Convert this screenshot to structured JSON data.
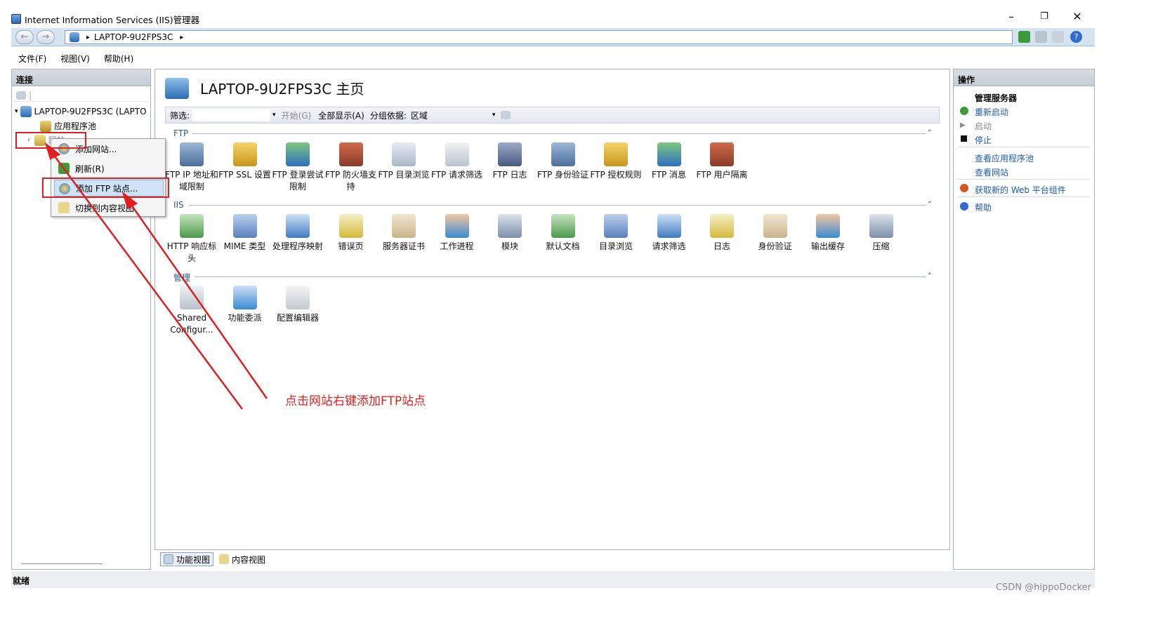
{
  "window": {
    "title": "Internet Information Services (IIS)管理器",
    "minimize": "–",
    "restore": "❐",
    "close": "✕"
  },
  "address": {
    "path_root": "▸",
    "server": "LAPTOP-9U2FPS3C",
    "path_end": "▸"
  },
  "menu": [
    "文件(F)",
    "视图(V)",
    "帮助(H)"
  ],
  "connections": {
    "header": "连接",
    "server_node": "LAPTOP-9U2FPS3C (LAPTO",
    "app_pools": "应用程序池",
    "sites": "网站"
  },
  "context_menu": [
    "添加网站...",
    "刷新(R)",
    "添加 FTP 站点...",
    "切换到内容视图"
  ],
  "center": {
    "title": "LAPTOP-9U2FPS3C 主页",
    "filter": {
      "label": "筛选:",
      "start": "开始(G)",
      "show_all": "全部显示(A)",
      "group_by": "分组依据:",
      "group_value": "区域"
    },
    "sections": {
      "ftp": {
        "title": "FTP",
        "items": [
          "FTP IP 地址和域限制",
          "FTP SSL 设置",
          "FTP 登录尝试限制",
          "FTP 防火墙支持",
          "FTP 目录浏览",
          "FTP 请求筛选",
          "FTP 日志",
          "FTP 身份验证",
          "FTP 授权规则",
          "FTP 消息",
          "FTP 用户隔离"
        ]
      },
      "iis": {
        "title": "IIS",
        "items": [
          "HTTP 响应标头",
          "MIME 类型",
          "处理程序映射",
          "错误页",
          "服务器证书",
          "工作进程",
          "模块",
          "默认文档",
          "目录浏览",
          "请求筛选",
          "日志",
          "身份验证",
          "输出缓存",
          "压缩"
        ]
      },
      "mgmt": {
        "title": "管理",
        "items": [
          "Shared Configur...",
          "功能委派",
          "配置编辑器"
        ]
      }
    },
    "tabs": {
      "features": "功能视图",
      "content": "内容视图"
    }
  },
  "actions": {
    "header": "操作",
    "group": "管理服务器",
    "restart": "重新启动",
    "start": "启动",
    "stop": "停止",
    "view_pools": "查看应用程序池",
    "view_sites": "查看网站",
    "get_components": "获取新的 Web 平台组件",
    "help": "帮助"
  },
  "status": "就绪",
  "annotation": "点击网站右键添加FTP站点",
  "watermark": "CSDN @hippoDocker",
  "colors": {
    "accent": "#1e5bb8",
    "annotation": "#e02020",
    "header_bg": "#c6ccd4"
  }
}
